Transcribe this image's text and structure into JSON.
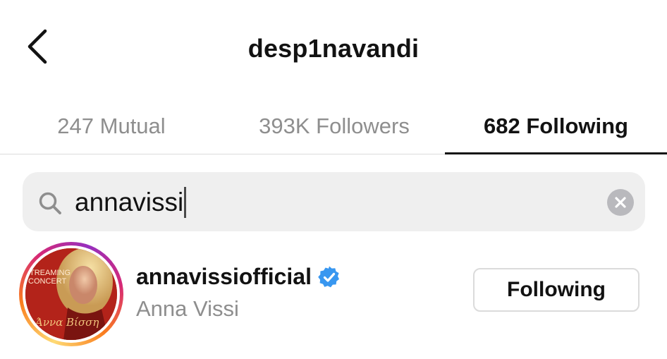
{
  "header": {
    "title": "desp1navandi",
    "back_icon": "chevron-left-icon"
  },
  "tabs": [
    {
      "label": "247 Mutual",
      "active": false
    },
    {
      "label": "393K Followers",
      "active": false
    },
    {
      "label": "682 Following",
      "active": true
    }
  ],
  "search": {
    "value": "annavissi",
    "search_icon": "search-icon",
    "clear_icon": "clear-circle-icon"
  },
  "results": [
    {
      "username": "annavissiofficial",
      "full_name": "Anna Vissi",
      "verified": true,
      "has_story": true,
      "button_label": "Following",
      "avatar_text": {
        "line1": "TREAMING",
        "line2": "CONCERT",
        "signature": "Άννα Βίσση"
      }
    }
  ],
  "colors": {
    "primary_text": "#121212",
    "secondary_text": "#8e8e8e",
    "search_bg": "#efefef",
    "divider": "#dbdbdb",
    "verified_blue": "#3897f0"
  }
}
